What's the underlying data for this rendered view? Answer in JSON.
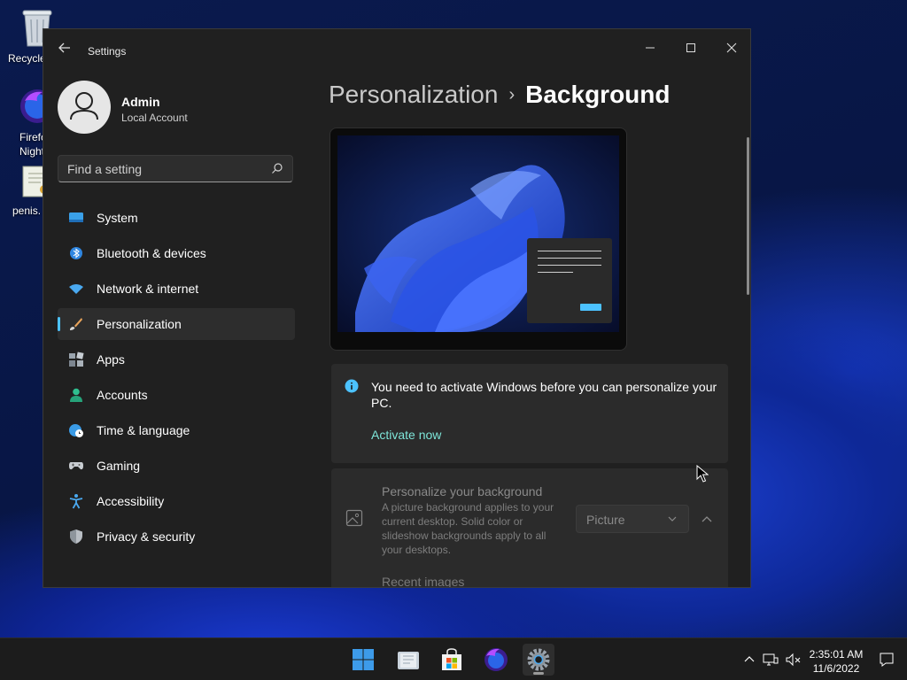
{
  "desktop": {
    "icons": [
      {
        "label": "Recycle Bin"
      },
      {
        "label": "Firefox Nightly"
      },
      {
        "label": "penis."
      }
    ]
  },
  "window": {
    "title": "Settings",
    "controls": {
      "minimize": "—",
      "maximize": "☐",
      "close": "✕"
    }
  },
  "profile": {
    "name": "Admin",
    "account_type": "Local Account"
  },
  "search": {
    "placeholder": "Find a setting"
  },
  "sidebar": {
    "items": [
      {
        "label": "System",
        "icon": "system-icon"
      },
      {
        "label": "Bluetooth & devices",
        "icon": "bluetooth-icon"
      },
      {
        "label": "Network & internet",
        "icon": "wifi-icon"
      },
      {
        "label": "Personalization",
        "icon": "brush-icon",
        "active": true
      },
      {
        "label": "Apps",
        "icon": "apps-icon"
      },
      {
        "label": "Accounts",
        "icon": "accounts-icon"
      },
      {
        "label": "Time & language",
        "icon": "globe-clock-icon"
      },
      {
        "label": "Gaming",
        "icon": "gamepad-icon"
      },
      {
        "label": "Accessibility",
        "icon": "accessibility-icon"
      },
      {
        "label": "Privacy & security",
        "icon": "shield-icon"
      }
    ]
  },
  "main": {
    "breadcrumb": {
      "parent": "Personalization",
      "separator": "›",
      "current": "Background"
    },
    "activation": {
      "message": "You need to activate Windows before you can personalize your PC.",
      "link": "Activate now"
    },
    "background": {
      "title": "Personalize your background",
      "description": "A picture background applies to your current desktop. Solid color or slideshow backgrounds apply to all your desktops.",
      "selected": "Picture",
      "recent_label": "Recent images"
    }
  },
  "taskbar": {
    "apps": [
      "start-icon",
      "file-explorer-icon",
      "store-icon",
      "firefox-nightly-icon",
      "settings-icon"
    ],
    "clock": {
      "time": "2:35:01 AM",
      "date": "11/6/2022"
    }
  },
  "colors": {
    "accent": "#4cc2ff",
    "link": "#7ee6d9",
    "window_bg": "#202020",
    "card_bg": "#2b2b2b"
  }
}
